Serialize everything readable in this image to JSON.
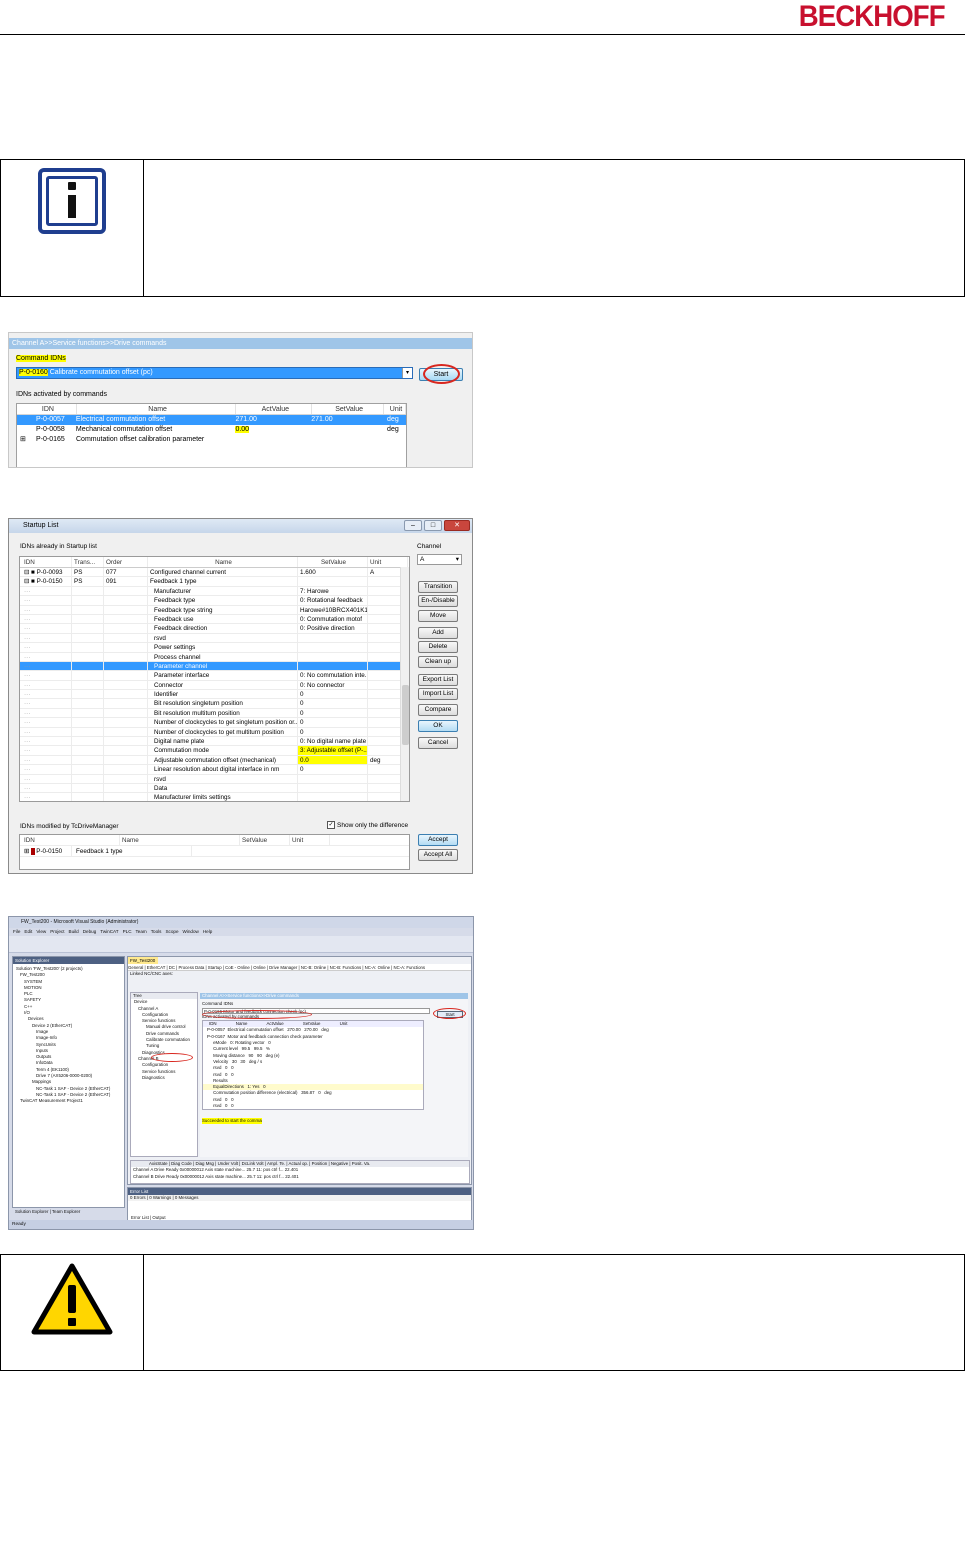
{
  "header": {
    "brand": "BECKHOFF"
  },
  "notes": {
    "info_icon": "info-icon",
    "warning_icon": "warning-triangle-icon"
  },
  "shot1": {
    "breadcrumb": "Channel A>>Service functions>>Drive commands",
    "command_label": "Command IDNs",
    "command_idn": "P-0-0160",
    "command_name": "Calibrate commutation offset (pc)",
    "start_label": "Start",
    "activated_label": "IDNs activated by commands",
    "columns": [
      "IDN",
      "Name",
      "ActValue",
      "SetValue",
      "Unit"
    ],
    "rows": [
      {
        "idn": "P-0-0057",
        "name": "Electrical commutation offset",
        "act": "271.00",
        "set": "271.00",
        "unit": "deg"
      },
      {
        "idn": "P-0-0058",
        "name": "Mechanical commutation offset",
        "act": "0.00",
        "set": "",
        "unit": "deg"
      },
      {
        "idn": "P-0-0165",
        "name": "Commutation offset calibration parameter",
        "act": "",
        "set": "",
        "unit": ""
      }
    ]
  },
  "shot2": {
    "title": "Startup List",
    "already_label": "IDNs already in Startup list",
    "channel_label": "Channel",
    "channel_value": "A",
    "columns": [
      "IDN",
      "Trans...",
      "Order",
      "Name",
      "SetValue",
      "Unit"
    ],
    "rows": [
      {
        "idn": "P-0-0093",
        "trans": "PS",
        "order": "077",
        "name": "Configured channel current",
        "value": "1.600",
        "unit": "A"
      },
      {
        "idn": "P-0-0150",
        "trans": "PS",
        "order": "091",
        "name": "Feedback 1 type",
        "value": "",
        "unit": ""
      },
      {
        "idn": "",
        "trans": "",
        "order": "",
        "name": "Manufacturer",
        "value": "7: Harowe",
        "unit": ""
      },
      {
        "idn": "",
        "trans": "",
        "order": "",
        "name": "Feedback type",
        "value": "0: Rotational feedback",
        "unit": ""
      },
      {
        "idn": "",
        "trans": "",
        "order": "",
        "name": "Feedback type string",
        "value": "Harowe#10BRCX401K1",
        "unit": ""
      },
      {
        "idn": "",
        "trans": "",
        "order": "",
        "name": "Feedback use",
        "value": "0: Commutation motof",
        "unit": ""
      },
      {
        "idn": "",
        "trans": "",
        "order": "",
        "name": "Feedback direction",
        "value": "0: Positive direction",
        "unit": ""
      },
      {
        "idn": "",
        "trans": "",
        "order": "",
        "name": "rsvd",
        "value": "",
        "unit": ""
      },
      {
        "idn": "",
        "trans": "",
        "order": "",
        "name": "Power settings",
        "value": "",
        "unit": ""
      },
      {
        "idn": "",
        "trans": "",
        "order": "",
        "name": "Process channel",
        "value": "",
        "unit": ""
      },
      {
        "idn": "",
        "trans": "",
        "order": "",
        "name": "Parameter channel",
        "value": "",
        "unit": ""
      },
      {
        "idn": "",
        "trans": "",
        "order": "",
        "name": "Parameter interface",
        "value": "0: No commutation inte...",
        "unit": ""
      },
      {
        "idn": "",
        "trans": "",
        "order": "",
        "name": "Connector",
        "value": "0: No connector",
        "unit": ""
      },
      {
        "idn": "",
        "trans": "",
        "order": "",
        "name": "Identifier",
        "value": "0",
        "unit": ""
      },
      {
        "idn": "",
        "trans": "",
        "order": "",
        "name": "Bit resolution singleturn position",
        "value": "0",
        "unit": ""
      },
      {
        "idn": "",
        "trans": "",
        "order": "",
        "name": "Bit resolution multiturn position",
        "value": "0",
        "unit": ""
      },
      {
        "idn": "",
        "trans": "",
        "order": "",
        "name": "Number of clockcycles to get singleturn position or...",
        "value": "0",
        "unit": ""
      },
      {
        "idn": "",
        "trans": "",
        "order": "",
        "name": "Number of clockcycles to get multiturn position",
        "value": "0",
        "unit": ""
      },
      {
        "idn": "",
        "trans": "",
        "order": "",
        "name": "Digital name plate",
        "value": "0: No digital name plate",
        "unit": ""
      },
      {
        "idn": "",
        "trans": "",
        "order": "",
        "name": "Commutation mode",
        "value": "3: Adjustable offset (P-...",
        "unit": ""
      },
      {
        "idn": "",
        "trans": "",
        "order": "",
        "name": "Adjustable commutation offset (mechanical)",
        "value": "0.0",
        "unit": "deg"
      },
      {
        "idn": "",
        "trans": "",
        "order": "",
        "name": "Linear resolution about digital interface in nm",
        "value": "0",
        "unit": ""
      },
      {
        "idn": "",
        "trans": "",
        "order": "",
        "name": "rsvd",
        "value": "",
        "unit": ""
      },
      {
        "idn": "",
        "trans": "",
        "order": "",
        "name": "Data",
        "value": "",
        "unit": ""
      },
      {
        "idn": "",
        "trans": "",
        "order": "",
        "name": "Manufacturer limits settings",
        "value": "",
        "unit": ""
      }
    ],
    "buttons": [
      "Transition",
      "En-/Disable",
      "Move",
      "Add",
      "Delete",
      "Clean up",
      "Export List",
      "Import List",
      "Compare",
      "OK",
      "Cancel"
    ],
    "modified_label": "IDNs modified by TcDriveManager",
    "only_diff_label": "Show only the difference",
    "mod_columns": [
      "IDN",
      "Name",
      "SetValue",
      "Unit"
    ],
    "mod_row": {
      "idn": "P-0-0150",
      "name": "Feedback 1 type"
    },
    "accept_label": "Accept",
    "accept_all_label": "Accept All"
  },
  "shot3": {
    "title": "FW_Test200 - Microsoft Visual Studio (Administrator)",
    "menu": [
      "File",
      "Edit",
      "View",
      "Project",
      "Build",
      "Debug",
      "TwinCAT",
      "PLC",
      "Team",
      "Tools",
      "Scope",
      "Window",
      "Help"
    ],
    "solution_head": "Solution Explorer",
    "solution_items": [
      "Solution 'FW_Test200' (2 projects)",
      "FW_Test200",
      "SYSTEM",
      "MOTION",
      "PLC",
      "SAFETY",
      "C++",
      "I/O",
      "Devices",
      "Device 2 (EtherCAT)",
      "Image",
      "Image-Info",
      "SyncUnits",
      "Inputs",
      "Outputs",
      "InfoData",
      "Term 4 (EK1100)",
      "Drive 7 (AX5206-0000-0200)",
      "Mappings",
      "NC-Task 1 SAF - Device 2 (EtherCAT)",
      "NC-Task 1 SAF - Device 2 (EtherCAT)",
      "TwinCAT Measurement Project1"
    ],
    "doc_tab": "FW_Test200",
    "tabs": "General | EtherCAT | DC | Process Data | Startup | CoE - Online | Online | Drive Manager | NC-B: Online | NC-B: Functions | NC-A: Online | NC-A: Functions",
    "linked": "Linked NC/CNC axes:",
    "tree": [
      "Device",
      "Channel A",
      "Configuration",
      "Service functions",
      "Manual drive control",
      "Drive commands",
      "Calibrate commutation",
      "Tuning",
      "Diagnostics",
      "Channel B",
      "Configuration",
      "Service functions",
      "Diagnostics"
    ],
    "breadcrumb": "Channel A>>Service functions>>Drive commands",
    "command_label": "Command IDNs",
    "command": "P-0-0166  Motor and feedback connection check (pc)",
    "start_label": "Start",
    "activated_label": "IDNs activated by commands",
    "table_rows": [
      "P-0-0057  Electrical commutation offset   270.00   270.00   deg",
      "P-0-0167  Motor and feedback connection check parameter",
      "     eMode   0: Rotating vector   0",
      "     Current level   99.5   99.5   %",
      "     Moving distance   90   90   deg (e)",
      "     Velocity   30   30   deg / s",
      "     rsvd   0   0",
      "     rsvd   0   0",
      "     Results",
      "     EqualDirections   1: Yes   0",
      "     Commutation position difference (electrical)   356.87   0   deg",
      "     rsvd   0   0",
      "     rsvd   0   0"
    ],
    "status": "Succeeded to start the command.",
    "grid_head": "AxisState | Diag Code | Diag Msg | Under Volt | DcLink Volt | Ampl. Te. | Actual op. | Position | Negative | Posit. Va.",
    "grid_rows": [
      "Channel A   Drive Ready  0x00000012  Axis state machine...   25.7   11: pos ctrl f...   22.401",
      "Channel B   Drive Ready  0x00000012  Axis state machine...   25.7   11: pos ctrl f...   22.401"
    ],
    "error_head": "Error List",
    "error_tabs": "0 Errors | 0 Warnings | 0 Messages",
    "bottom_tabs": "Solution Explorer | Team Explorer",
    "output_tabs": "Error List | Output",
    "statusbar": "Ready"
  }
}
